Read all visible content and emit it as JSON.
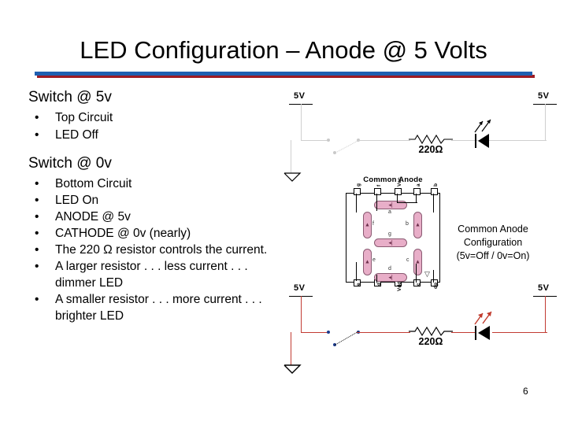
{
  "slide": {
    "title": "LED Configuration – Anode @ 5 Volts",
    "number": "6",
    "accent_blue": "#1f5fb0",
    "accent_red": "#9e1b23"
  },
  "left": {
    "heading_1": "Switch @ 5v",
    "bullets_1": [
      "Top Circuit",
      "LED Off"
    ],
    "heading_2": "Switch @ 0v",
    "bullets_2": [
      "Bottom Circuit",
      "LED On",
      "ANODE @ 5v",
      "CATHODE @ 0v (nearly)",
      "The 220 Ω resistor controls the current.",
      "A larger resistor . . . less current . . . dimmer LED",
      "A smaller resistor . . . more current . . . brighter LED"
    ],
    "bullet_glyph": "•"
  },
  "caption": {
    "line_1": "Common Anode",
    "line_2": "Configuration",
    "line_3": "(5v=Off / 0v=On)"
  },
  "top_circuit": {
    "supply_left_label": "5V",
    "supply_right_label": "5V",
    "resistor_label": "220Ω",
    "led_state": "off",
    "led_color": "#000000"
  },
  "bottom_circuit": {
    "supply_left_label": "5V",
    "supply_right_label": "5V",
    "resistor_label": "220Ω",
    "led_state": "on",
    "led_color": "#c0392b",
    "wire_color": "#c23b33"
  },
  "package": {
    "title": "Common Anode",
    "pins_top": [
      "g",
      "f",
      "Vcc",
      "a",
      "b"
    ],
    "pins_bottom": [
      "e",
      "d",
      "Vdd",
      "c",
      "dp"
    ],
    "segment_labels": [
      "a",
      "b",
      "c",
      "d",
      "e",
      "f",
      "g"
    ],
    "segment_color": "#e8aec8"
  }
}
